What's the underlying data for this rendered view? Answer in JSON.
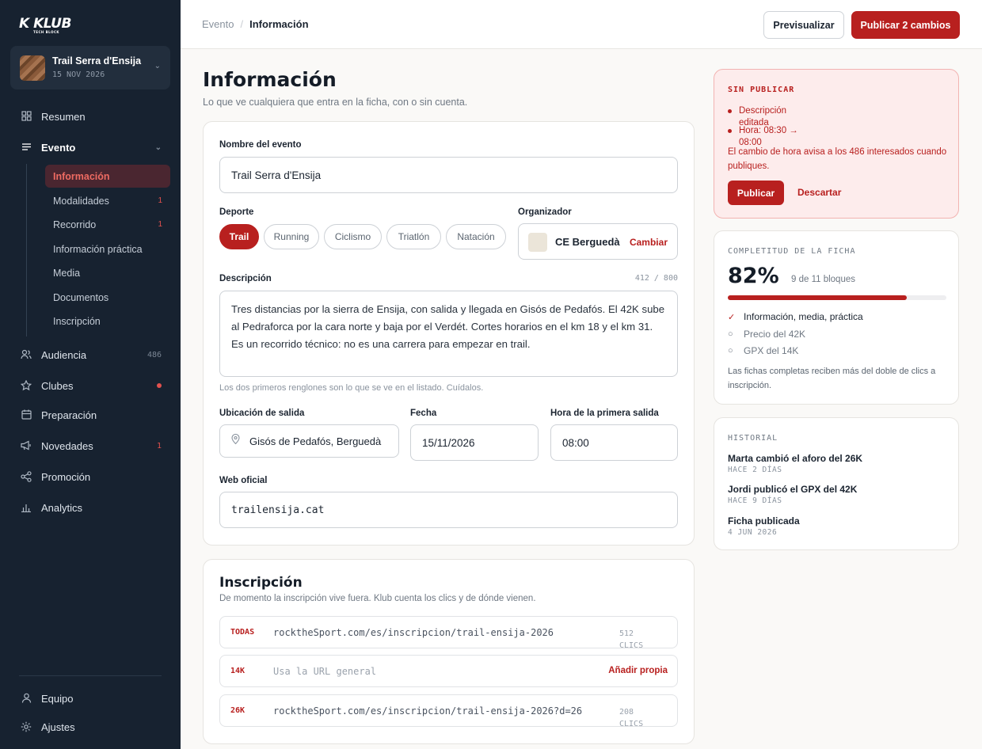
{
  "brand": {
    "logo": "K KLUB",
    "tagline": "TECH BLOCK"
  },
  "event": {
    "title": "Trail Serra d'Ensija",
    "date": "15 NOV 2026"
  },
  "nav": {
    "resumen": "Resumen",
    "evento": "Evento",
    "evento_sub": [
      {
        "label": "Información",
        "count": ""
      },
      {
        "label": "Modalidades",
        "count": "1"
      },
      {
        "label": "Recorrido",
        "count": "1"
      },
      {
        "label": "Información práctica",
        "count": ""
      },
      {
        "label": "Media",
        "count": ""
      },
      {
        "label": "Documentos",
        "count": ""
      },
      {
        "label": "Inscripción",
        "count": ""
      }
    ],
    "audiencia": "Audiencia",
    "audiencia_count": "486",
    "clubes": "Clubes",
    "preparacion": "Preparación",
    "novedades": "Novedades",
    "novedades_count": "1",
    "promocion": "Promoción",
    "analytics": "Analytics",
    "equipo": "Equipo",
    "ajustes": "Ajustes"
  },
  "topbar": {
    "crumb_parent": "Evento",
    "crumb_sep": "/",
    "crumb_current": "Información",
    "preview": "Previsualizar",
    "publish": "Publicar 2 cambios"
  },
  "main": {
    "title": "Información",
    "subtitle": "Lo que ve cualquiera que entra en la ficha, con o sin cuenta.",
    "name_label": "Nombre del evento",
    "name_value": "Trail Serra d'Ensija",
    "sport_label": "Deporte",
    "sports": [
      "Trail",
      "Running",
      "Ciclismo",
      "Triatlón",
      "Natación"
    ],
    "organizer_label": "Organizador",
    "organizer_name": "CE Berguedà",
    "organizer_change": "Cambiar",
    "desc_label": "Descripción",
    "desc_counter": "412 / 800",
    "desc_value": "Tres distancias por la sierra de Ensija, con salida y llegada en Gisós de Pedafós. El 42K sube al Pedraforca por la cara norte y baja por el Verdét. Cortes horarios en el km 18 y el km 31. Es un recorrido técnico: no es una carrera para empezar en trail.",
    "desc_hint": "Los dos primeros renglones son lo que se ve en el listado. Cuídalos.",
    "location_label": "Ubicación de salida",
    "location_value": "Gisós de Pedafós, Berguedà",
    "date_label": "Fecha",
    "date_value": "15/11/2026",
    "time_label": "Hora de la primera salida",
    "time_value": "08:00",
    "web_label": "Web oficial",
    "web_value": "trailensija.cat"
  },
  "inscripcion": {
    "title": "Inscripción",
    "subtitle": "De momento la inscripción vive fuera. Klub cuenta los clics y de dónde vienen.",
    "rows": [
      {
        "tag": "TODAS",
        "url": "rocktheSport.com/es/inscripcion/trail-ensija-2026",
        "clicks": "512 CLICS"
      },
      {
        "tag": "14K",
        "url": "Usa la URL general",
        "action": "Añadir propia"
      },
      {
        "tag": "26K",
        "url": "rocktheSport.com/es/inscripcion/trail-ensija-2026?d=26",
        "clicks": "208 CLICS"
      }
    ]
  },
  "unpublished": {
    "heading": "SIN PUBLICAR",
    "items": [
      "Descripción editada",
      "Hora: 08:30 → 08:00"
    ],
    "note": "El cambio de hora avisa a los 486 interesados cuando publiques.",
    "publish": "Publicar",
    "discard": "Descartar"
  },
  "completeness": {
    "heading": "COMPLETITUD DE LA FICHA",
    "percent_label": "82%",
    "percent": 0.82,
    "blocks": "9 de 11 bloques",
    "items": [
      {
        "label": "Información, media, práctica",
        "done": true
      },
      {
        "label": "Precio del 42K",
        "done": false
      },
      {
        "label": "GPX del 14K",
        "done": false
      }
    ],
    "note": "Las fichas completas reciben más del doble de clics a inscripción."
  },
  "history": {
    "heading": "HISTORIAL",
    "items": [
      {
        "text": "Marta cambió el aforo del 26K",
        "when": "HACE 2 DÍAS"
      },
      {
        "text": "Jordi publicó el GPX del 42K",
        "when": "HACE 9 DÍAS"
      },
      {
        "text": "Ficha publicada",
        "when": "4 JUN 2026"
      }
    ]
  },
  "colors": {
    "accent": "#b8201f",
    "sidebar": "#172230",
    "alert_bg": "#fdecec"
  }
}
